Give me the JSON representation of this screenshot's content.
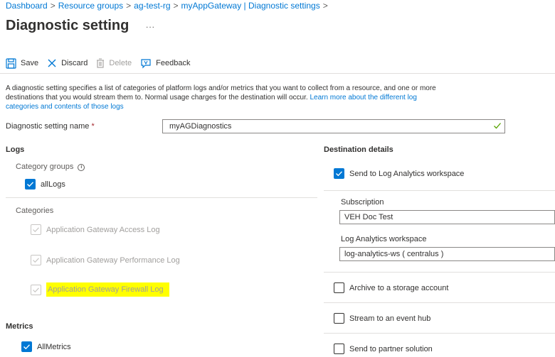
{
  "breadcrumb": {
    "items": [
      "Dashboard",
      "Resource groups",
      "ag-test-rg",
      "myAppGateway | Diagnostic settings"
    ],
    "separator": ">"
  },
  "page": {
    "title": "Diagnostic setting",
    "more": "..."
  },
  "toolbar": {
    "save_label": "Save",
    "discard_label": "Discard",
    "delete_label": "Delete",
    "feedback_label": "Feedback"
  },
  "description": {
    "text": "A diagnostic setting specifies a list of categories of platform logs and/or metrics that you want to collect from a resource, and one or more destinations that you would stream them to. Normal usage charges for the destination will occur.",
    "link_text": "Learn more about the different log categories and contents of those logs"
  },
  "name_field": {
    "label": "Diagnostic setting name",
    "required_marker": "*",
    "value": "myAGDiagnostics"
  },
  "logs": {
    "heading": "Logs",
    "category_groups_label": "Category groups",
    "all_logs_label": "allLogs",
    "categories_label": "Categories",
    "categories": [
      "Application Gateway Access Log",
      "Application Gateway Performance Log",
      "Application Gateway Firewall Log"
    ]
  },
  "metrics": {
    "heading": "Metrics",
    "all_metrics_label": "AllMetrics"
  },
  "destination": {
    "heading": "Destination details",
    "log_analytics_label": "Send to Log Analytics workspace",
    "subscription_label": "Subscription",
    "subscription_value": "VEH Doc Test",
    "workspace_label": "Log Analytics workspace",
    "workspace_value": "log-analytics-ws ( centralus )",
    "storage_label": "Archive to a storage account",
    "event_hub_label": "Stream to an event hub",
    "partner_label": "Send to partner solution"
  },
  "colors": {
    "accent": "#0078d4",
    "highlight": "#ffff00",
    "valid_check": "#57a300"
  }
}
